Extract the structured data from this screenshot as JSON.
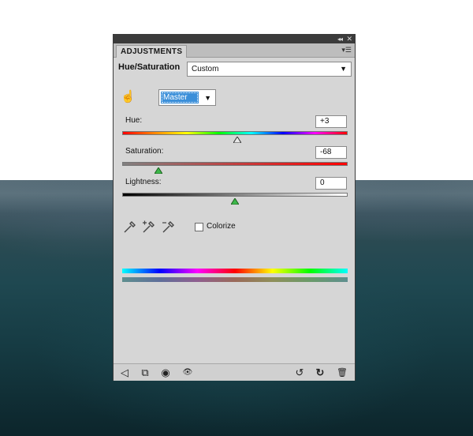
{
  "panel": {
    "tab_label": "ADJUSTMENTS",
    "collapse_glyph": "◂◂",
    "close_glyph": "✕",
    "menu_glyph": "▾☰",
    "heading": "Hue/Saturation",
    "preset": {
      "value": "Custom",
      "caret": "▼"
    },
    "channel": {
      "value": "Master",
      "caret": "▼"
    },
    "hand_tool_icon": "☝",
    "hue": {
      "label": "Hue:",
      "value": "+3",
      "level": 0.51
    },
    "saturation": {
      "label": "Saturation:",
      "value": "-68",
      "level": 0.16
    },
    "lightness": {
      "label": "Lightness:",
      "value": "0",
      "level": 0.5
    },
    "eyedroppers": [
      "eyedropper-icon",
      "eyedropper-plus-icon",
      "eyedropper-minus-icon"
    ],
    "colorize_label": "Colorize",
    "colorize_checked": false,
    "bottom_icons": {
      "back": "◁",
      "clip": "⧉",
      "visibility_toggle": "◉",
      "eye": "👁",
      "view_previous": "↺",
      "reset": "↻",
      "trash": "🗑"
    }
  }
}
